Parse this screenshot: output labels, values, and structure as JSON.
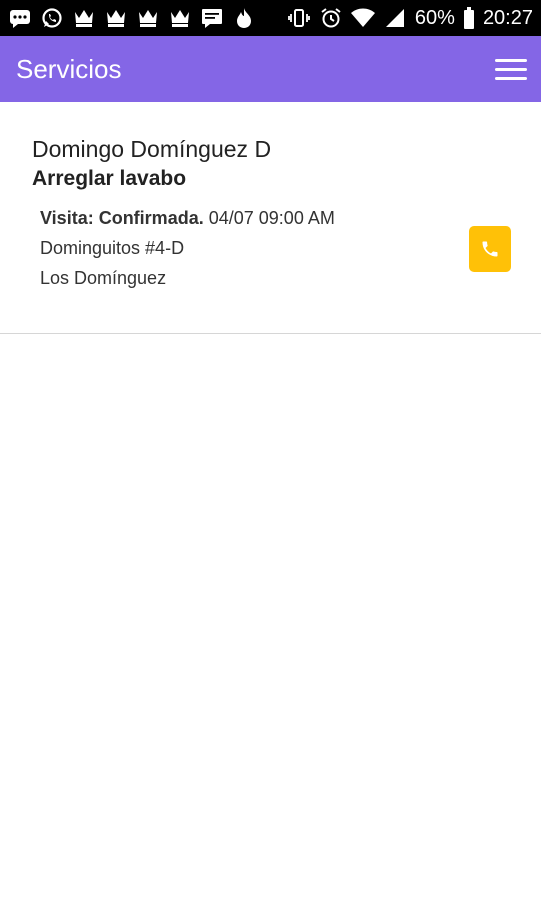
{
  "status_bar": {
    "battery": "60%",
    "time": "20:27",
    "left_icons": [
      "messages-icon",
      "whatsapp-icon",
      "crown-icon",
      "crown-icon",
      "crown-icon",
      "crown-icon",
      "chat-icon",
      "fire-icon"
    ],
    "right_icons": [
      "vibrate-icon",
      "alarm-icon",
      "wifi-icon",
      "signal-icon",
      "battery-icon"
    ]
  },
  "app_bar": {
    "title": "Servicios",
    "color": "#8466E6"
  },
  "service": {
    "client": "Domingo Domínguez D",
    "title": "Arreglar lavabo",
    "visit_label": "Visita: Confirmada.",
    "visit_datetime": "04/07 09:00 AM",
    "address": "Dominguitos #4-D",
    "area": "Los Domínguez",
    "call_button_color": "#FFC107"
  }
}
